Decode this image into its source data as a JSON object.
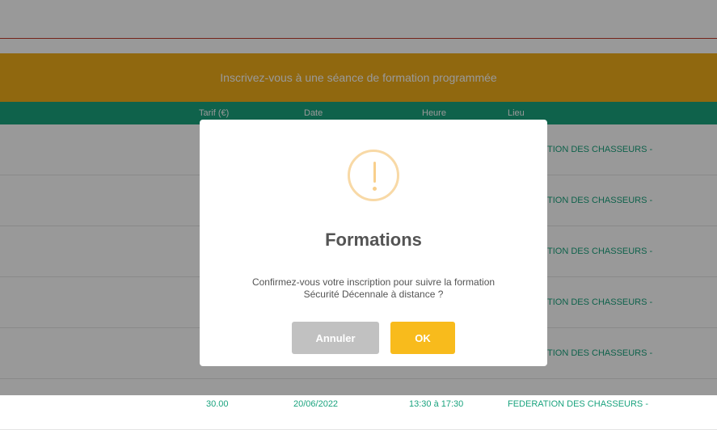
{
  "banner": {
    "text": "Inscrivez-vous à une séance de formation programmée"
  },
  "table": {
    "headers": {
      "tarif": "Tarif (€)",
      "date": "Date",
      "heure": "Heure",
      "lieu": "Lieu"
    },
    "rows": [
      {
        "tarif": "",
        "date": "",
        "heure": "",
        "lieu": "TION DES CHASSEURS -"
      },
      {
        "tarif": "",
        "date": "",
        "heure": "",
        "lieu": "TION DES CHASSEURS -"
      },
      {
        "tarif": "",
        "date": "",
        "heure": "",
        "lieu": "TION DES CHASSEURS -"
      },
      {
        "tarif": "",
        "date": "",
        "heure": "",
        "lieu": "TION DES CHASSEURS -"
      },
      {
        "tarif": "",
        "date": "",
        "heure": "",
        "lieu": "TION DES CHASSEURS -"
      },
      {
        "tarif": "30.00",
        "date": "20/06/2022",
        "heure": "13:30 à 17:30",
        "lieu": "FEDERATION DES CHASSEURS -"
      }
    ]
  },
  "modal": {
    "icon": "warning-icon",
    "title": "Formations",
    "text_line1": "Confirmez-vous votre inscription pour suivre la formation",
    "text_line2": "Sécurité Décennale à distance ?",
    "cancel_label": "Annuler",
    "ok_label": "OK"
  },
  "colors": {
    "banner": "#f0ad1a",
    "header": "#1aa37e",
    "accent_text": "#1aa37e",
    "ok_button": "#f8bb1c",
    "cancel_button": "#c1c1c1",
    "warning_icon": "#f8cf8c",
    "top_border": "#c0392b"
  }
}
